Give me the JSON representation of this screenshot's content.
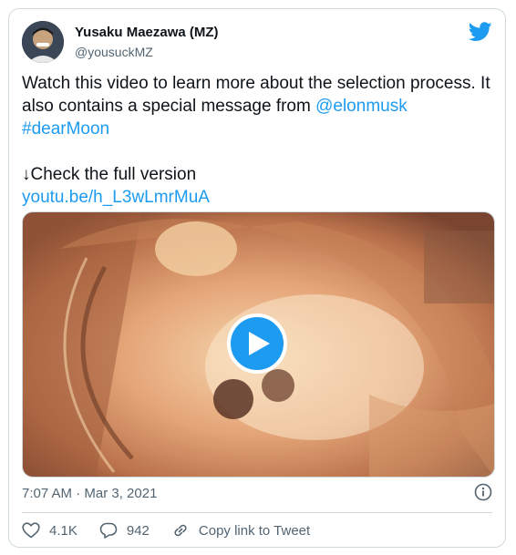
{
  "author": {
    "name": "Yusaku Maezawa (MZ)",
    "handle": "@yousuckMZ"
  },
  "tweet": {
    "line1": "Watch this video to learn more about the selection process. It also contains a special message from",
    "mention": "@elonmusk",
    "hashtag": "#dearMoon",
    "line2": "↓Check the full version",
    "url": "youtu.be/h_L3wLmrMuA"
  },
  "meta": {
    "timestamp": "7:07 AM · Mar 3, 2021"
  },
  "actions": {
    "likes": "4.1K",
    "replies": "942",
    "copy_link": "Copy link to Tweet"
  },
  "colors": {
    "accent": "#1d9bf0",
    "secondary_text": "#536471"
  },
  "icons": [
    "twitter-bird-icon",
    "play-icon",
    "info-icon",
    "heart-icon",
    "reply-icon",
    "link-icon"
  ]
}
